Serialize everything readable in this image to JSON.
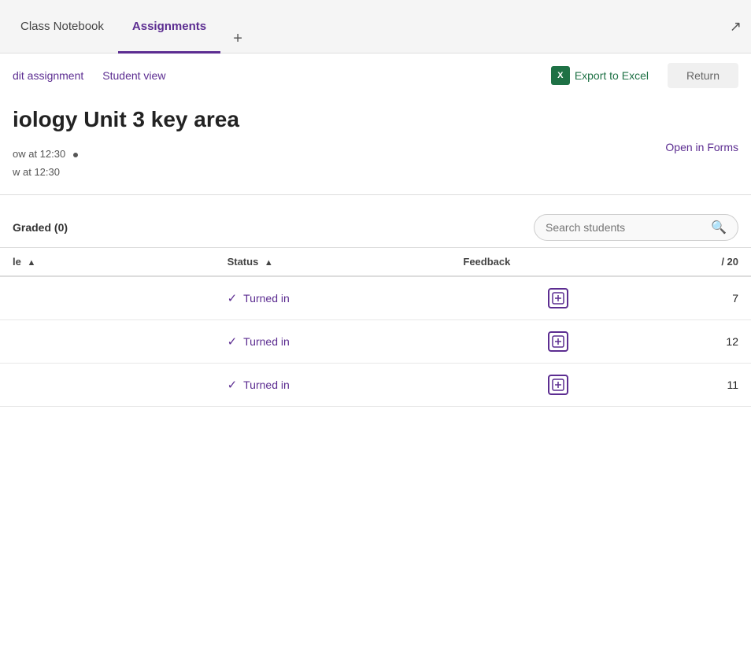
{
  "tabs": [
    {
      "id": "class-notebook",
      "label": "Class Notebook",
      "active": false
    },
    {
      "id": "assignments",
      "label": "Assignments",
      "active": true
    }
  ],
  "tab_add_label": "+",
  "expand_icon": "↗",
  "toolbar": {
    "edit_label": "dit assignment",
    "student_view_label": "Student view",
    "export_label": "Export to Excel",
    "return_label": "Return"
  },
  "assignment": {
    "title": "iology Unit 3 key area",
    "due_line1": "ow at 12:30",
    "due_line2": "w at 12:30",
    "open_forms_label": "Open in Forms"
  },
  "filters": {
    "tabs": [
      {
        "id": "graded",
        "label": "Graded (0)",
        "active": true
      }
    ],
    "search_placeholder": "Search students"
  },
  "table": {
    "columns": [
      {
        "id": "name",
        "label": "le",
        "sortable": true
      },
      {
        "id": "status",
        "label": "Status",
        "sortable": true
      },
      {
        "id": "feedback",
        "label": "Feedback",
        "sortable": false
      },
      {
        "id": "score",
        "label": "/ 20",
        "sortable": false
      }
    ],
    "rows": [
      {
        "name": "",
        "status": "Turned in",
        "score": "7"
      },
      {
        "name": "",
        "status": "Turned in",
        "score": "12"
      },
      {
        "name": "",
        "status": "Turned in",
        "score": "11"
      }
    ]
  }
}
